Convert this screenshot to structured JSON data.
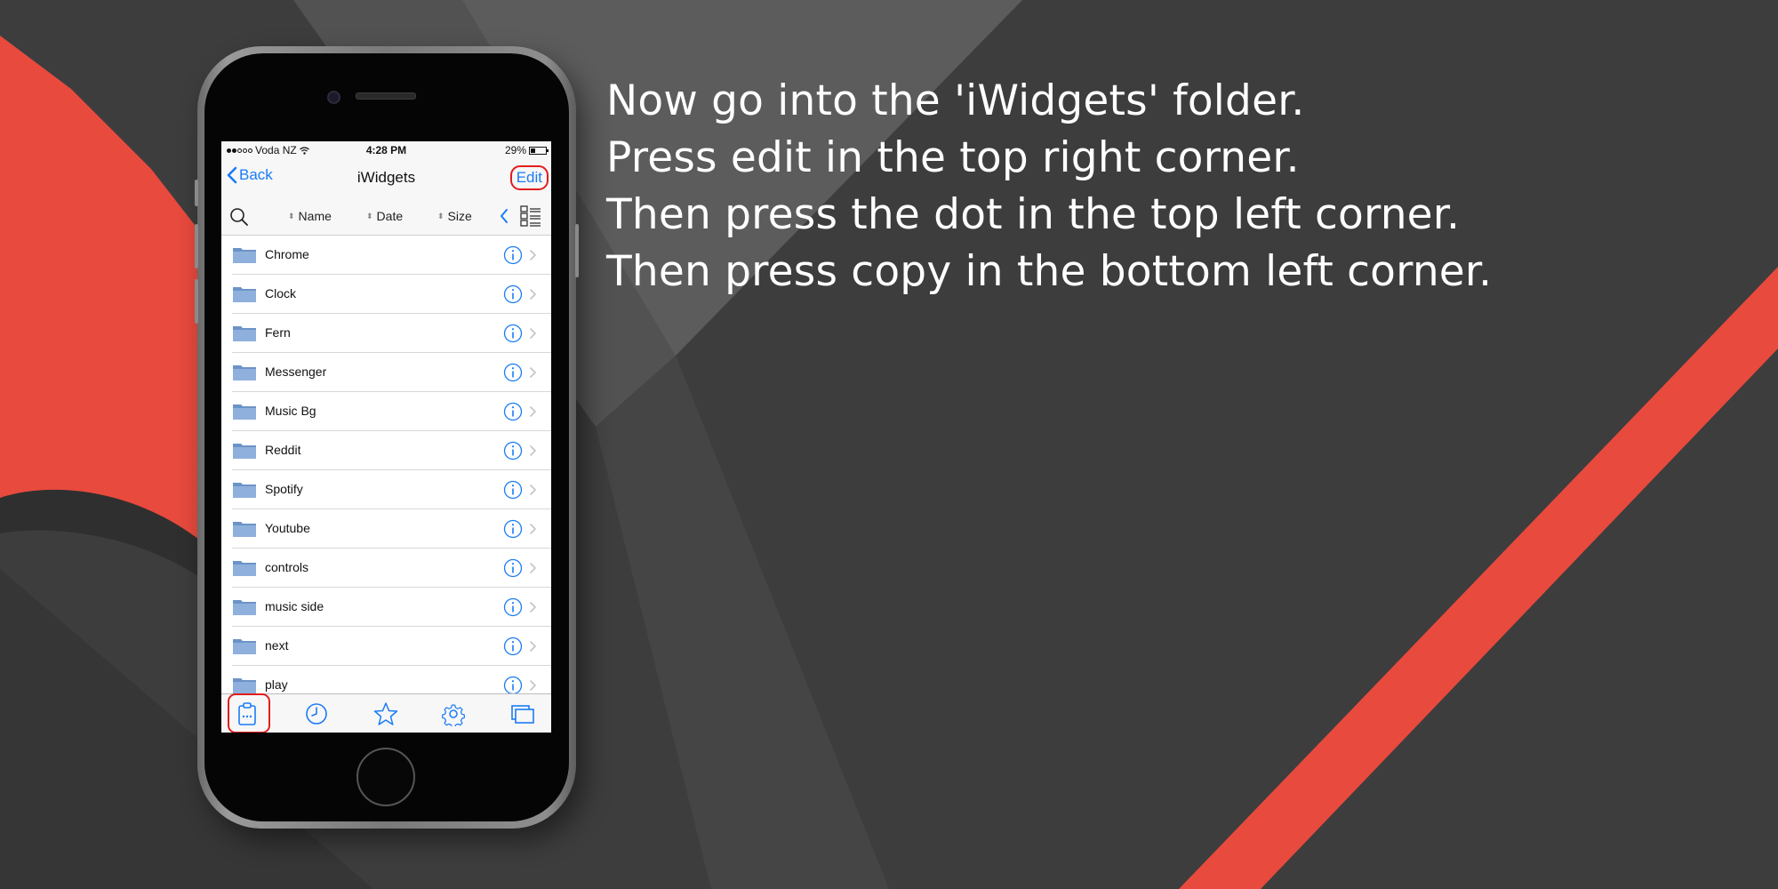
{
  "instructions": [
    "Now go into the 'iWidgets' folder.",
    "Press edit in the top right corner.",
    "Then press the dot in the top left corner.",
    "Then press copy in the bottom left corner."
  ],
  "status_bar": {
    "carrier": "Voda NZ",
    "time": "4:28 PM",
    "battery": "29%"
  },
  "nav": {
    "back_label": "Back",
    "title": "iWidgets",
    "edit_label": "Edit"
  },
  "sort": {
    "name_label": "Name",
    "date_label": "Date",
    "size_label": "Size"
  },
  "files": [
    "Chrome",
    "Clock",
    "Fern",
    "Messenger",
    "Music Bg",
    "Reddit",
    "Spotify",
    "Youtube",
    "controls",
    "music side",
    "next",
    "play"
  ],
  "tabs": [
    "clipboard-icon",
    "clock-icon",
    "star-icon",
    "gear-icon",
    "windows-icon"
  ],
  "colors": {
    "accent": "#1a7cf5",
    "highlight": "#e21d1d",
    "background_red": "#e84a3d",
    "background_dark": "#3b3b3b"
  }
}
